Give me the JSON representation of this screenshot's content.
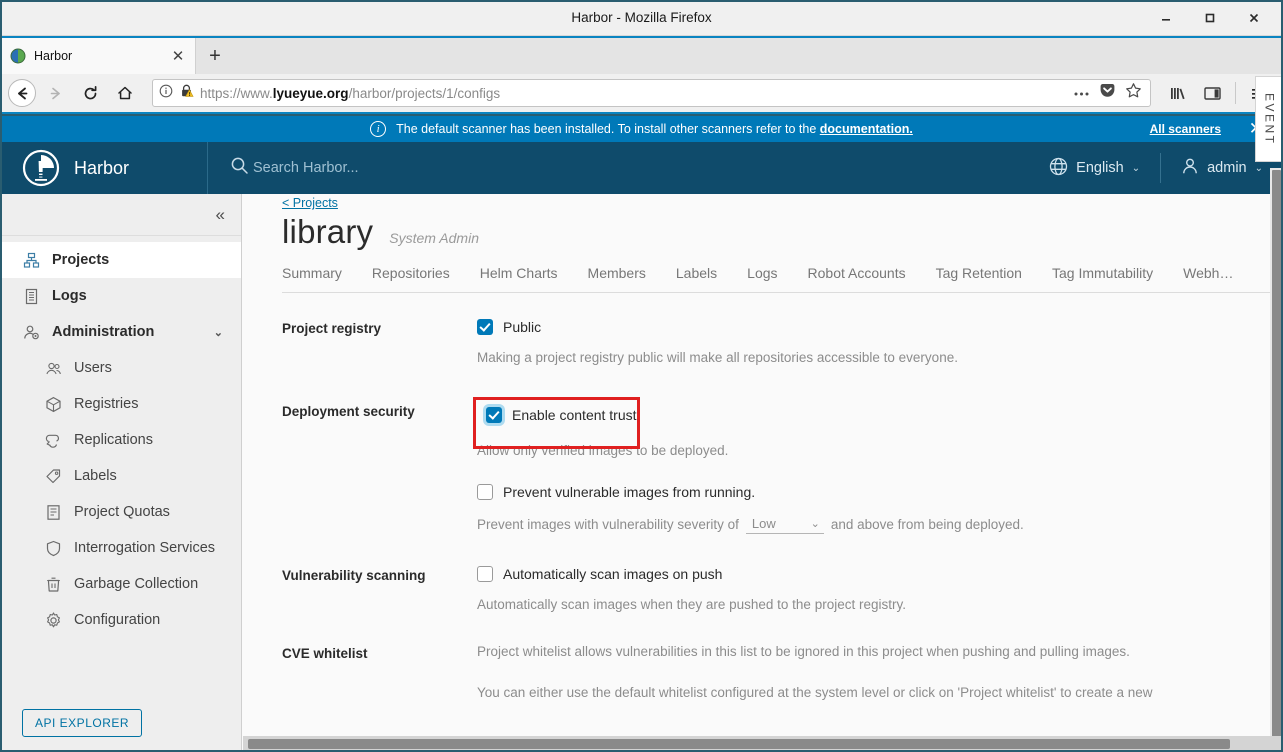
{
  "browser": {
    "window_title": "Harbor - Mozilla Firefox",
    "minimize_label": "–",
    "maximize_label": "□",
    "close_label": "✕",
    "tab": {
      "title": "Harbor",
      "close_label": "✕",
      "favicon": "harbor-favicon"
    },
    "new_tab_label": "+",
    "nav": {
      "back": "←",
      "forward": "→",
      "reload": "⟳",
      "home": "⌂"
    },
    "url": {
      "scheme": "https://www.",
      "domain": "lyueyue.org",
      "path": "/harbor/projects/1/configs"
    },
    "url_icons": [
      "info-icon",
      "lock-warning-icon"
    ],
    "url_actions": [
      "page-actions-icon",
      "pocket-icon",
      "bookmark-star-icon"
    ],
    "right_icons": [
      "library-icon",
      "sidebar-icon",
      "hamburger-menu-icon"
    ]
  },
  "notice": {
    "text": "The default scanner has been installed. To install other scanners refer to the ",
    "link": "documentation.",
    "all_scanners": "All scanners",
    "close": "✕",
    "bg_color": "#0079b8"
  },
  "header": {
    "brand": "Harbor",
    "search_placeholder": "Search Harbor...",
    "language": "English",
    "user": "admin",
    "bg_color": "#0f4b6b"
  },
  "sidebar": {
    "collapse_label": "«",
    "items": [
      {
        "label": "Projects",
        "icon": "projects-icon",
        "active": true,
        "bold": true,
        "sub": false
      },
      {
        "label": "Logs",
        "icon": "logs-icon",
        "active": false,
        "bold": true,
        "sub": false
      },
      {
        "label": "Administration",
        "icon": "administration-icon",
        "active": false,
        "bold": true,
        "sub": false,
        "chevron": "⌄"
      },
      {
        "label": "Users",
        "icon": "users-icon",
        "active": false,
        "bold": false,
        "sub": true
      },
      {
        "label": "Registries",
        "icon": "registries-icon",
        "active": false,
        "bold": false,
        "sub": true
      },
      {
        "label": "Replications",
        "icon": "replications-icon",
        "active": false,
        "bold": false,
        "sub": true
      },
      {
        "label": "Labels",
        "icon": "labels-icon",
        "active": false,
        "bold": false,
        "sub": true
      },
      {
        "label": "Project Quotas",
        "icon": "project-quotas-icon",
        "active": false,
        "bold": false,
        "sub": true
      },
      {
        "label": "Interrogation Services",
        "icon": "interrogation-services-icon",
        "active": false,
        "bold": false,
        "sub": true
      },
      {
        "label": "Garbage Collection",
        "icon": "garbage-collection-icon",
        "active": false,
        "bold": false,
        "sub": true
      },
      {
        "label": "Configuration",
        "icon": "configuration-icon",
        "active": false,
        "bold": false,
        "sub": true
      }
    ],
    "api_explorer": "API EXPLORER",
    "accent_color": "#0072a3"
  },
  "main": {
    "breadcrumb": "< Projects",
    "project_name": "library",
    "project_role": "System Admin",
    "tabs": [
      "Summary",
      "Repositories",
      "Helm Charts",
      "Members",
      "Labels",
      "Logs",
      "Robot Accounts",
      "Tag Retention",
      "Tag Immutability",
      "Webh…"
    ],
    "sections": {
      "project_registry": {
        "label": "Project registry",
        "checkbox_label": "Public",
        "checked": true,
        "helper": "Making a project registry public will make all repositories accessible to everyone."
      },
      "deployment_security": {
        "label": "Deployment security",
        "content_trust": {
          "checkbox_label": "Enable content trust",
          "checked": true,
          "highlighted": true,
          "helper": "Allow only verified images to be deployed."
        },
        "prevent_vulnerable": {
          "checkbox_label": "Prevent vulnerable images from running.",
          "checked": false,
          "prefix": "Prevent images with vulnerability severity of",
          "severity_value": "Low",
          "suffix": "and above from being deployed."
        }
      },
      "vulnerability_scanning": {
        "label": "Vulnerability scanning",
        "checkbox_label": "Automatically scan images on push",
        "checked": false,
        "helper": "Automatically scan images when they are pushed to the project registry."
      },
      "cve_whitelist": {
        "label": "CVE whitelist",
        "helper1": "Project whitelist allows vulnerabilities in this list to be ignored in this project when pushing and pulling images.",
        "helper2": "You can either use the default whitelist configured at the system level or click on 'Project whitelist' to create a new"
      }
    }
  },
  "event_panel": {
    "label": "EVENT"
  },
  "colors": {
    "highlight_box": "#e02020",
    "checkbox_on": "#0079b8",
    "link": "#0072a3"
  }
}
